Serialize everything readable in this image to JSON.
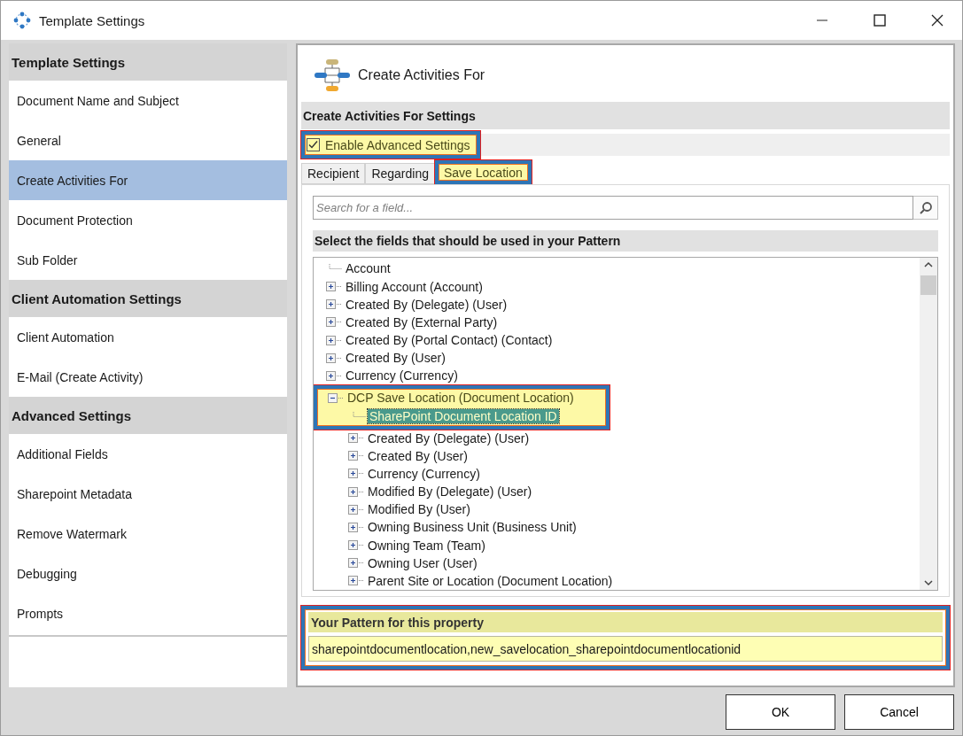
{
  "window": {
    "title": "Template Settings"
  },
  "sidebar": {
    "sections": [
      {
        "title": "Template Settings",
        "items": [
          {
            "label": "Document Name and Subject",
            "selected": false
          },
          {
            "label": "General",
            "selected": false
          },
          {
            "label": "Create Activities For",
            "selected": true
          },
          {
            "label": "Document Protection",
            "selected": false
          },
          {
            "label": "Sub Folder",
            "selected": false
          }
        ]
      },
      {
        "title": "Client Automation Settings",
        "items": [
          {
            "label": "Client Automation",
            "selected": false
          },
          {
            "label": "E-Mail (Create Activity)",
            "selected": false
          }
        ]
      },
      {
        "title": "Advanced Settings",
        "items": [
          {
            "label": "Additional Fields",
            "selected": false
          },
          {
            "label": "Sharepoint Metadata",
            "selected": false
          },
          {
            "label": "Remove Watermark",
            "selected": false
          },
          {
            "label": "Debugging",
            "selected": false
          },
          {
            "label": "Prompts",
            "selected": false
          }
        ]
      }
    ]
  },
  "panel": {
    "title": "Create Activities For",
    "settings_header": "Create Activities For Settings",
    "enable_advanced": {
      "label": "Enable Advanced Settings",
      "checked": true,
      "highlighted": true
    },
    "tabs": [
      {
        "label": "Recipient",
        "selected": false,
        "highlighted": false
      },
      {
        "label": "Regarding",
        "selected": false,
        "highlighted": false
      },
      {
        "label": "Save Location",
        "selected": true,
        "highlighted": true
      }
    ],
    "search": {
      "placeholder": "Search for a field..."
    },
    "fields_header": "Select the fields that should be used in your Pattern",
    "tree": [
      {
        "label": "Account",
        "kind": "leaf",
        "selected": false,
        "highlighted": false
      },
      {
        "label": "Billing Account (Account)",
        "kind": "collapsed",
        "selected": false,
        "highlighted": false
      },
      {
        "label": "Created By (Delegate) (User)",
        "kind": "collapsed",
        "selected": false,
        "highlighted": false
      },
      {
        "label": "Created By (External Party)",
        "kind": "collapsed",
        "selected": false,
        "highlighted": false
      },
      {
        "label": "Created By (Portal Contact) (Contact)",
        "kind": "collapsed",
        "selected": false,
        "highlighted": false
      },
      {
        "label": "Created By (User)",
        "kind": "collapsed",
        "selected": false,
        "highlighted": false
      },
      {
        "label": "Currency (Currency)",
        "kind": "collapsed",
        "selected": false,
        "highlighted": false
      },
      {
        "label": "DCP Save Location (Document Location)",
        "kind": "expanded",
        "selected": false,
        "highlighted": true,
        "children": [
          {
            "label": "SharePoint Document Location ID",
            "kind": "leaf",
            "selected": true,
            "highlighted": true
          },
          {
            "label": "Created By (Delegate) (User)",
            "kind": "collapsed",
            "selected": false,
            "highlighted": false
          },
          {
            "label": "Created By (User)",
            "kind": "collapsed",
            "selected": false,
            "highlighted": false
          },
          {
            "label": "Currency (Currency)",
            "kind": "collapsed",
            "selected": false,
            "highlighted": false
          },
          {
            "label": "Modified By (Delegate) (User)",
            "kind": "collapsed",
            "selected": false,
            "highlighted": false
          },
          {
            "label": "Modified By (User)",
            "kind": "collapsed",
            "selected": false,
            "highlighted": false
          },
          {
            "label": "Owning Business Unit (Business Unit)",
            "kind": "collapsed",
            "selected": false,
            "highlighted": false
          },
          {
            "label": "Owning Team (Team)",
            "kind": "collapsed",
            "selected": false,
            "highlighted": false
          },
          {
            "label": "Owning User (User)",
            "kind": "collapsed",
            "selected": false,
            "highlighted": false
          },
          {
            "label": "Parent Site or Location (Document Location)",
            "kind": "collapsed",
            "selected": false,
            "highlighted": false
          }
        ]
      }
    ],
    "pattern": {
      "label": "Your Pattern for this property",
      "value": "sharepointdocumentlocation,new_savelocation_sharepointdocumentlocationid",
      "highlighted": true
    }
  },
  "buttons": [
    "OK",
    "Cancel"
  ]
}
